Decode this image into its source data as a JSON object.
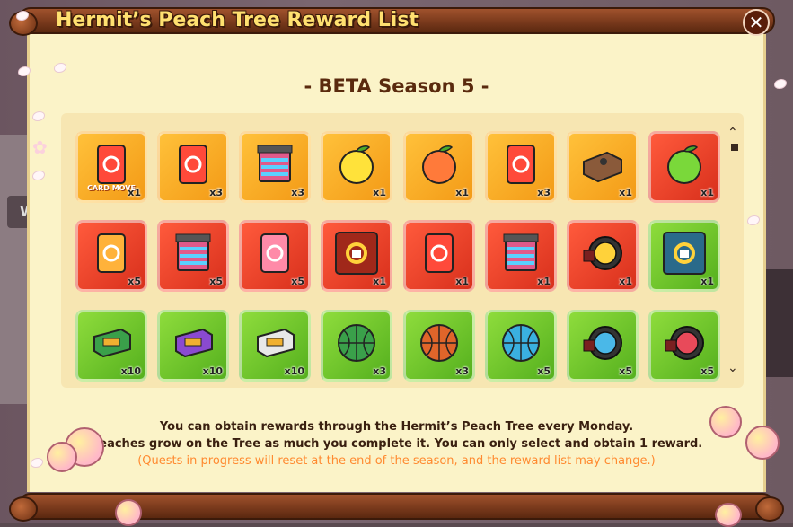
{
  "header": {
    "title": "Hermit’s Peach Tree Reward List",
    "close_label": "✕"
  },
  "season_label": "- BETA Season 5 -",
  "background": {
    "tab_label": "We"
  },
  "rewards": [
    {
      "icon": "card-move-icon",
      "color": "orange",
      "qty": "x1",
      "label": "CARD MOVE"
    },
    {
      "icon": "card-swap-icon",
      "color": "orange",
      "qty": "x3"
    },
    {
      "icon": "rainbow-card-pack-icon",
      "color": "orange",
      "qty": "x3"
    },
    {
      "icon": "golden-peach-icon",
      "color": "orange",
      "qty": "x1"
    },
    {
      "icon": "peach-icon",
      "color": "orange",
      "qty": "x1"
    },
    {
      "icon": "card-lock-new-icon",
      "color": "orange",
      "qty": "x3"
    },
    {
      "icon": "wooden-box-icon",
      "color": "orange",
      "qty": "x1"
    },
    {
      "icon": "green-peach-icon",
      "color": "red",
      "qty": "x1"
    },
    {
      "icon": "gold-card-swap-icon",
      "color": "red",
      "qty": "x5"
    },
    {
      "icon": "rainbow-pack-icon",
      "color": "red",
      "qty": "x5"
    },
    {
      "icon": "pink-card-lock-icon",
      "color": "red",
      "qty": "x5"
    },
    {
      "icon": "shirt-swap-icon",
      "color": "red",
      "qty": "x1"
    },
    {
      "icon": "red-card-swap-icon",
      "color": "red",
      "qty": "x1"
    },
    {
      "icon": "rainbow-card-pack-icon",
      "color": "red",
      "qty": "x1"
    },
    {
      "icon": "gold-rocket-wheel-icon",
      "color": "red",
      "qty": "x1"
    },
    {
      "icon": "blue-shirt-swap-icon",
      "color": "green",
      "qty": "x1"
    },
    {
      "icon": "green-ticket-box-icon",
      "color": "green",
      "qty": "x10"
    },
    {
      "icon": "purple-ticket-box-icon",
      "color": "green",
      "qty": "x10"
    },
    {
      "icon": "white-ticket-box-icon",
      "color": "green",
      "qty": "x10"
    },
    {
      "icon": "green-basketball-icon",
      "color": "green",
      "qty": "x3"
    },
    {
      "icon": "orange-basketball-icon",
      "color": "green",
      "qty": "x3"
    },
    {
      "icon": "blue-basketball-icon",
      "color": "green",
      "qty": "x5"
    },
    {
      "icon": "blue-rocket-wheel-icon",
      "color": "green",
      "qty": "x5"
    },
    {
      "icon": "red-rocket-wheel-icon",
      "color": "green",
      "qty": "x5"
    }
  ],
  "scroll": {
    "up": "⌃",
    "down": "⌄"
  },
  "description": {
    "line1": "You can obtain rewards through the Hermit’s Peach Tree every Monday.",
    "line2": "Peaches grow on the Tree as much you complete it. You can only select and obtain 1 reward.",
    "line3": "(Quests in progress will reset at the end of the season, and the reward list may change.)"
  },
  "colors": {
    "title_text": "#ffe070",
    "warning_text": "#ff8a30",
    "paper": "#fbf3c8"
  }
}
